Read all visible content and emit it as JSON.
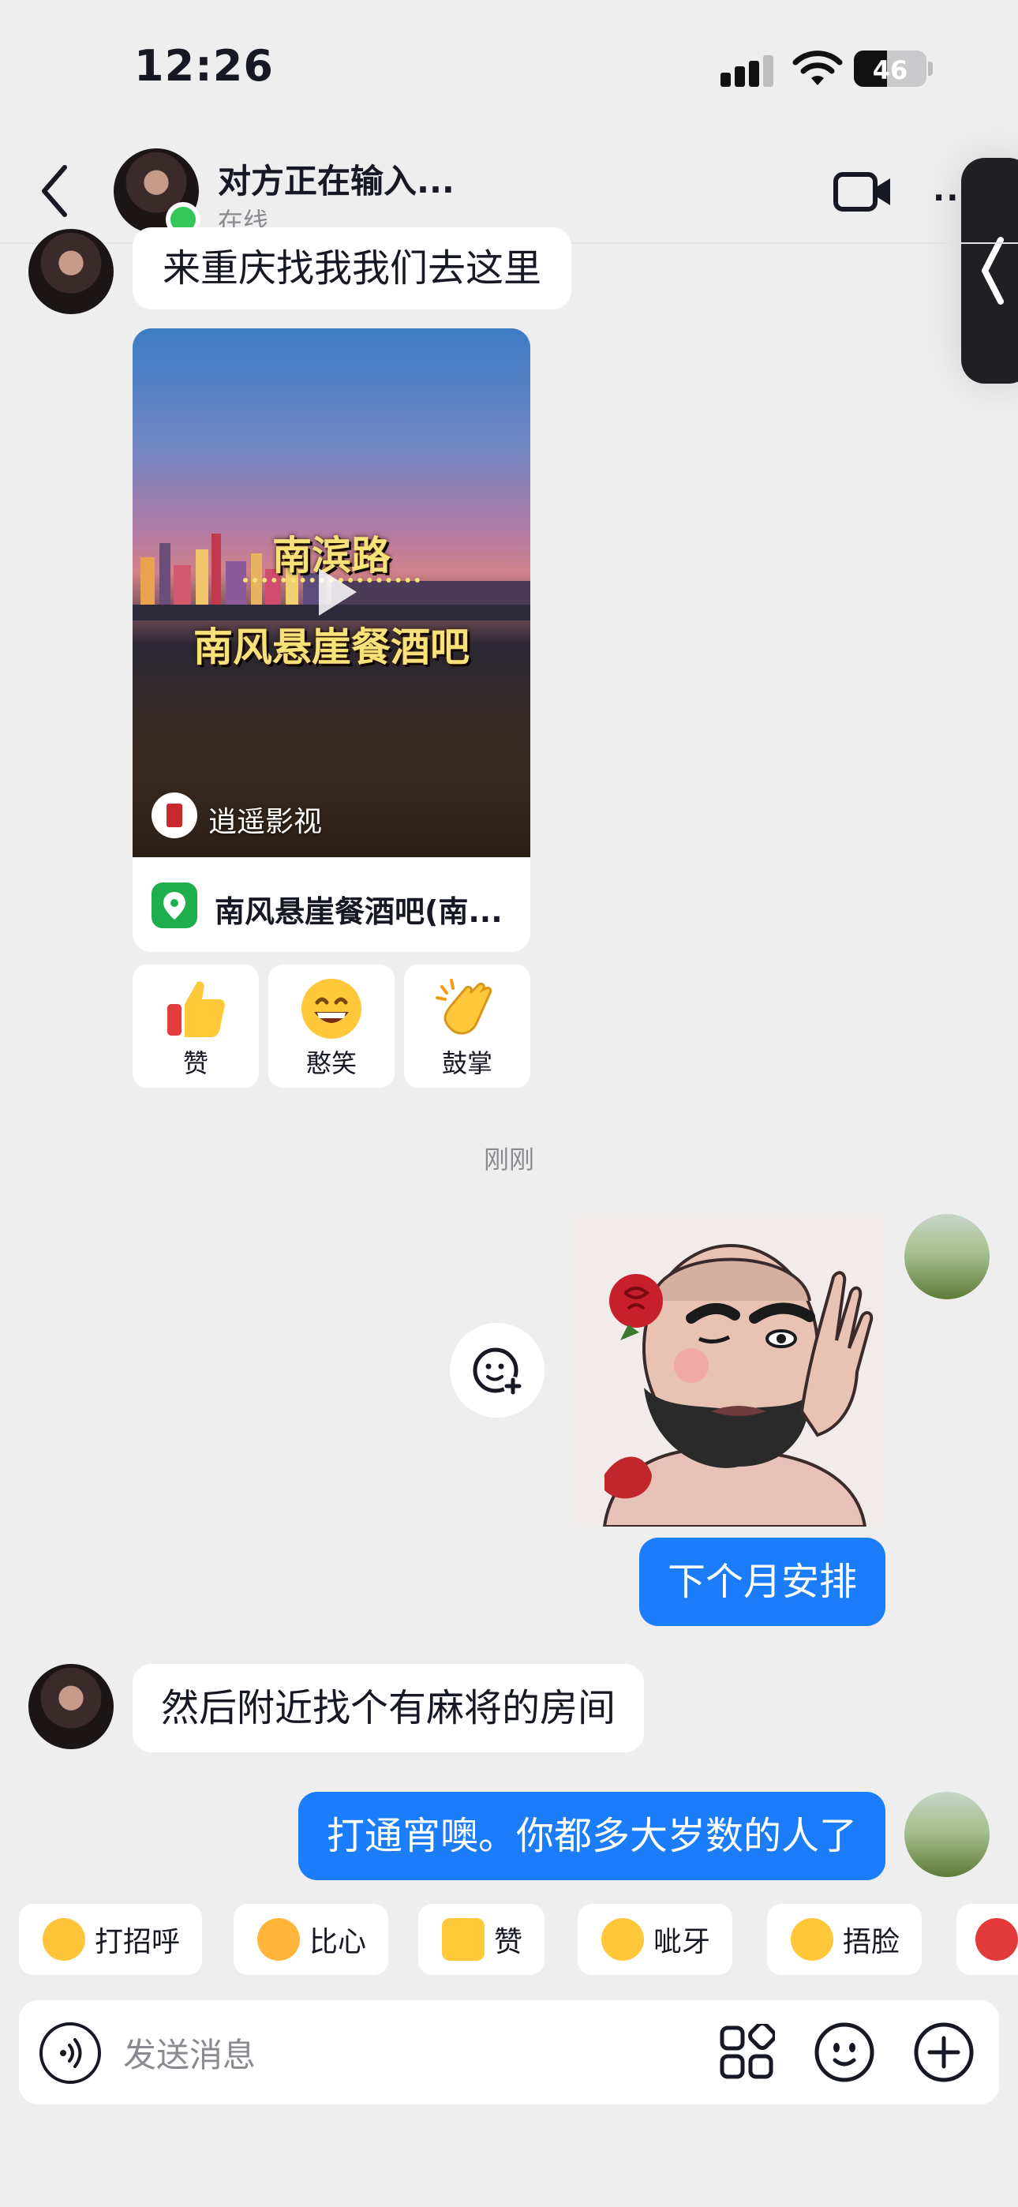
{
  "status_bar": {
    "time": "12:26",
    "battery": "46",
    "battery_level": 0.46
  },
  "header": {
    "title": "对方正在输入...",
    "status": "在线"
  },
  "messages": {
    "m1": "来重庆找我我们去这里",
    "video": {
      "title_line1": "南滨路",
      "title_line2": "南风悬崖餐酒吧",
      "channel": "逍遥影视",
      "location": "南风悬崖餐酒吧(南..."
    },
    "reactions": [
      {
        "label": "赞",
        "icon": "thumbs-up-icon"
      },
      {
        "label": "憨笑",
        "icon": "grin-icon"
      },
      {
        "label": "鼓掌",
        "icon": "clap-icon"
      }
    ],
    "time_divider": "刚刚",
    "m2": "下个月安排",
    "m3": "然后附近找个有麻将的房间",
    "m4": "打通宵噢。你都多大岁数的人了"
  },
  "quick_replies": [
    {
      "label": "打招呼",
      "icon": "wave-face-icon"
    },
    {
      "label": "比心",
      "icon": "finger-heart-icon"
    },
    {
      "label": "赞",
      "icon": "thumbs-up-icon"
    },
    {
      "label": "呲牙",
      "icon": "grin-teeth-icon"
    },
    {
      "label": "捂脸",
      "icon": "facepalm-icon"
    }
  ],
  "input": {
    "placeholder": "发送消息"
  },
  "colors": {
    "accent": "#1b7dfa",
    "online": "#36c75c",
    "background": "#eeeeef"
  }
}
